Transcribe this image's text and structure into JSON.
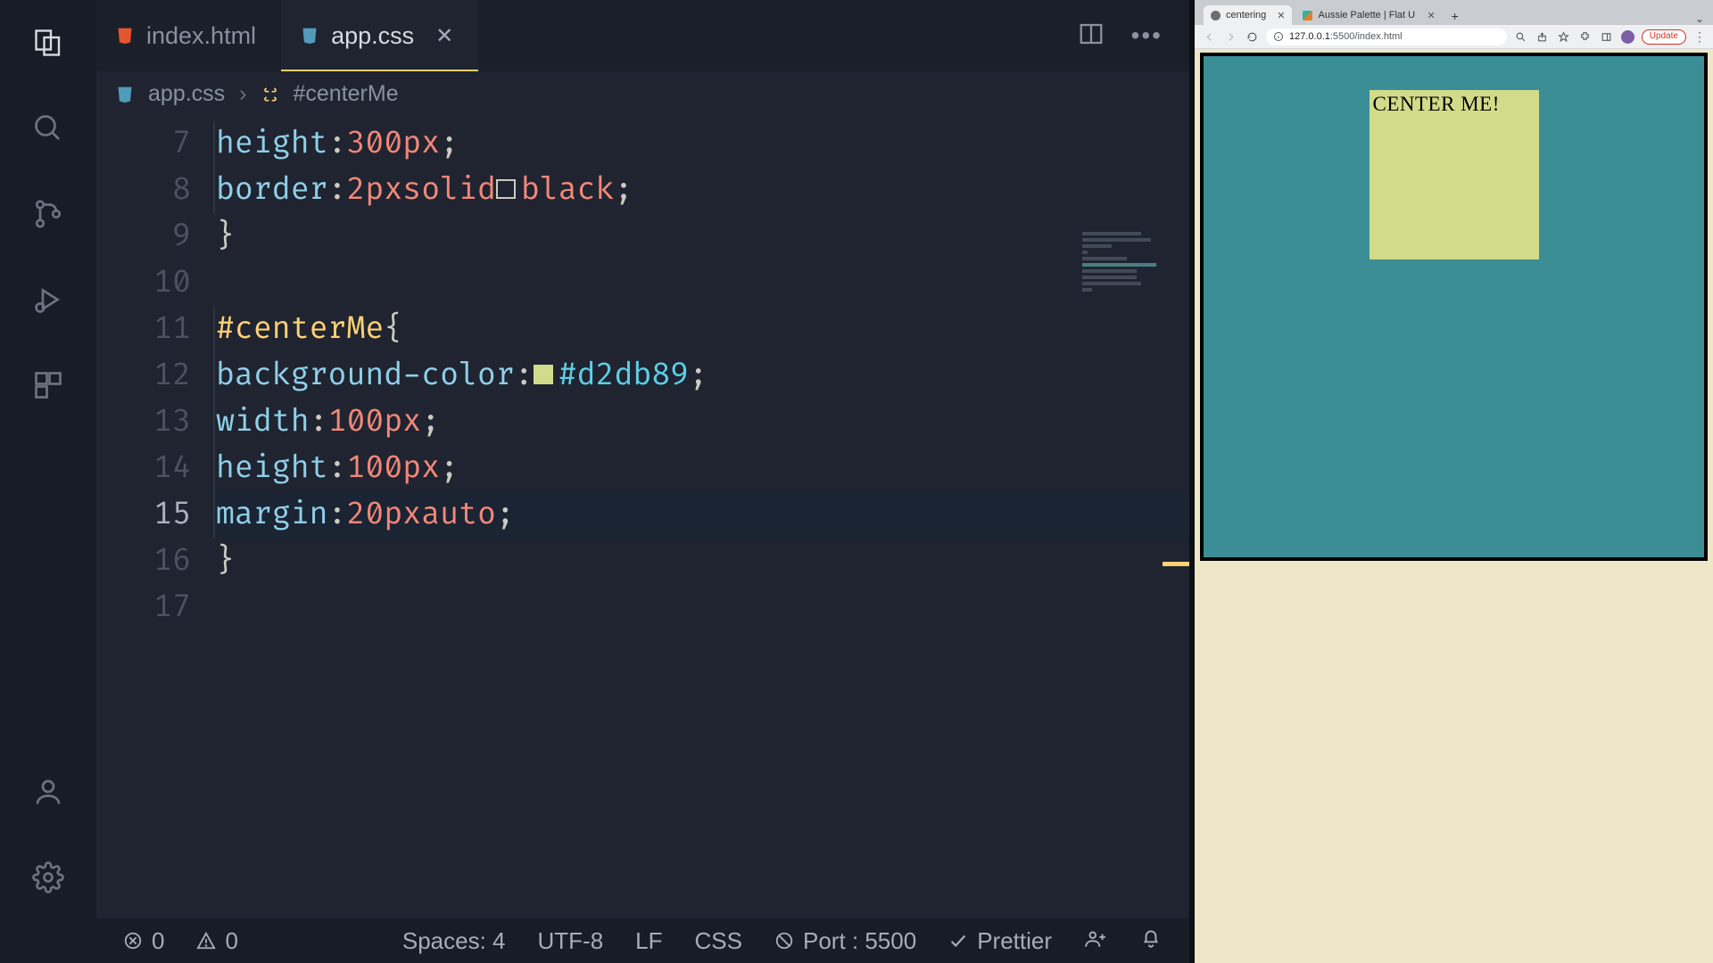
{
  "vscode": {
    "tabs": [
      {
        "label": "index.html",
        "icon_color": "#e4552d"
      },
      {
        "label": "app.css",
        "icon_color": "#519aba"
      }
    ],
    "breadcrumbs": {
      "file": "app.css",
      "symbol": "#centerMe"
    },
    "gutter": [
      "7",
      "8",
      "9",
      "10",
      "11",
      "12",
      "13",
      "14",
      "15",
      "16",
      "17"
    ],
    "code": {
      "l7_prop": "height",
      "l7_val": "300px",
      "l8_prop": "border",
      "l8_val1": "2px",
      "l8_val2": "solid",
      "l8_val3": "black",
      "l11_sel": "#centerMe",
      "l12_prop": "background-color",
      "l12_val": "#d2db89",
      "l13_prop": "width",
      "l13_val": "100px",
      "l14_prop": "height",
      "l14_val": "100px",
      "l15_prop": "margin",
      "l15_val1": "20px",
      "l15_val2": "auto"
    },
    "colors": {
      "swatch_black": "#ffffff00",
      "swatch_green": "#d2db89"
    },
    "status": {
      "errors": "0",
      "warnings": "0",
      "spaces": "Spaces: 4",
      "encoding": "UTF-8",
      "eol": "LF",
      "lang": "CSS",
      "port": "Port : 5500",
      "formatter": "Prettier"
    }
  },
  "chrome": {
    "tabs": [
      {
        "title": "centering",
        "favicon": "#6e6e6e"
      },
      {
        "title": "Aussie Palette | Flat UI Colo…",
        "favicon": "#2fb59a"
      }
    ],
    "url_host": "127.0.0.1",
    "url_port": ":5500",
    "url_path": "/index.html",
    "update": "Update",
    "page_text": "CENTER ME!"
  }
}
